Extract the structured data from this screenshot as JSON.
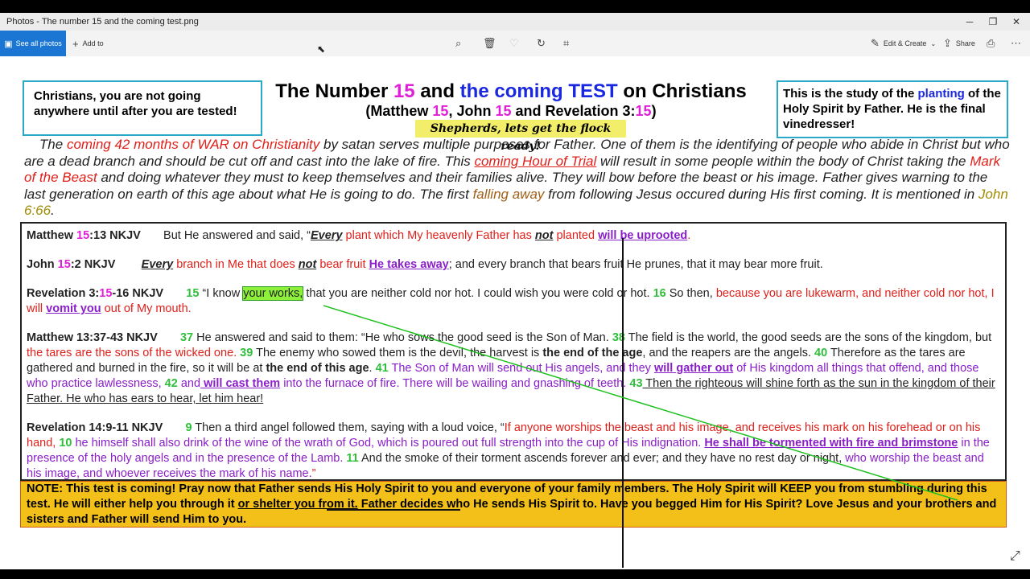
{
  "window": {
    "title": "Photos - The number 15 and the coming test.png",
    "minimize": "─",
    "restore": "❐",
    "close": "✕"
  },
  "toolbar": {
    "see_all_photos": "See all photos",
    "add_to": "Add to",
    "edit_create": "Edit & Create",
    "share": "Share"
  },
  "slide": {
    "left_box": "Christians, you are not going anywhere until after you are tested!",
    "right_box": {
      "a": "This is the study of the ",
      "planting": "planting",
      "b": " of the Holy Spirit by Father. He is the final vinedresser!"
    },
    "title": {
      "a": "The Number ",
      "n": "15",
      "b": " and ",
      "c": "the coming TEST",
      "d": " on Christians"
    },
    "subtitle": {
      "a": "(Matthew ",
      "n1": "15",
      "b": ", John ",
      "n2": "15",
      "c": " and Revelation 3:",
      "n3": "15",
      "d": ")"
    },
    "shepherds": "Shepherds, lets get the flock ready!",
    "intro": {
      "p1": "The ",
      "p2": "coming 42 months of WAR on Christianity",
      "p3": " by satan serves multiple purposes for Father. One of them is the identifying of people who abide in Christ but who are a dead branch and should be cut off and cast into the lake of fire. This ",
      "p4": "coming Hour of Trial",
      "p5": " will result in some people within the body of Christ taking the ",
      "p6": "Mark of the Beast",
      "p7": " and doing whatever they must to keep themselves and their families alive. They will bow before the beast or his image. Father gives warning to the last generation on earth of this age about what He is going to do. The first ",
      "p8": "falling away",
      "p9": " from following Jesus occured during His first coming. It is mentioned in ",
      "p10": "John 6:66",
      "p11": "."
    },
    "matthew15": {
      "ref_a": "Matthew ",
      "ref_n": "15",
      "ref_b": ":13 NKJV",
      "t1": "But He answered and said, “",
      "t2": "Every",
      "t3": " plant which My heavenly Father has ",
      "t4": "not",
      "t5": " planted ",
      "t6": "will be uprooted",
      "t7": "."
    },
    "john15": {
      "ref_a": "John ",
      "ref_n": "15",
      "ref_b": ":2 NKJV",
      "t1": "Every",
      "t2": " branch in Me that does ",
      "t3": "not",
      "t4": " bear fruit ",
      "t5": "He takes away",
      "t6": "; and every branch that bears fruit He prunes, that it may bear more fruit."
    },
    "rev3": {
      "ref_a": "Revelation 3:",
      "ref_n": "15",
      "ref_b": "-16 NKJV",
      "v15": "15",
      "t1": " “I know ",
      "t2": "your works,",
      "t3": " that you are neither cold nor hot. I could wish you were cold or hot. ",
      "v16": "16",
      "t4": " So then, ",
      "t5": "because you are lukewarm, and neither cold nor hot,",
      "t6": " I will ",
      "t7": "vomit you",
      "t8": " out of My mouth."
    },
    "matt13": {
      "ref": "Matthew 13:37-43 NKJV",
      "v37": "37",
      "t1": " He answered and said to them: “He who sows the good seed is the Son of Man. ",
      "v38": "38",
      "t2": " The field is the world, the good seeds are the sons of the kingdom, but ",
      "t3": "the tares are the sons of the wicked one.",
      "v39": " 39",
      "t4": " The enemy who sowed them is the devil, the harvest is ",
      "t5": "the end of the age",
      "t6": ", and the reapers are the angels. ",
      "v40": "40",
      "t7": " Therefore as the tares are gathered and burned in the fire, so it will be at ",
      "t8": "the end of this age",
      "t9": ". ",
      "v41": "41",
      "t10": " The Son of Man will send out His angels, and they ",
      "t11": "will gather out",
      "t12": " of His kingdom all things that offend, and those who practice lawlessness, ",
      "v42": "42",
      "t13": " and",
      "t14": " will cast them",
      "t15": " into the furnace of fire. There will be wailing and gnashing of teeth. ",
      "v43": "43",
      "t16": " Then the righteous will shine forth as the sun in the kingdom of their Father. He who has ears to hear, let him hear!"
    },
    "rev14": {
      "ref": "Revelation 14:9-11 NKJV",
      "v9": "9",
      "t1": " Then a third angel followed them, saying with a loud voice, “",
      "t2": "If anyone worships the beast and his image, and receives his mark on his forehead or on his hand,",
      "v10": " 10",
      "t3": " he himself shall also drink of the wine of the wrath of God, which is poured out full strength into the cup of His indignation.",
      "t4": "He shall be tormented with fire and brimstone",
      "t5": " in the presence of the holy angels and in the presence of the Lamb. ",
      "v11": "11",
      "t6": " And the smoke of their torment ascends forever and ever; and they have no rest day or night, ",
      "t7": "who worship the beast and his image, and whoever receives the mark of his name.",
      "t8": "”"
    },
    "note": {
      "a": "NOTE: This test is coming! Pray now that Father sends His Holy Spirit to you and everyone of your family members. The Holy Spirit will KEEP you from stumbling during this test. He will either help you through it ",
      "b": "or shelter you from it.",
      "c": " Father decides who He sends His Spirit to. Have you begged Him for His Spirit? Love Jesus and your brothers and sisters and Father will send Him to you."
    },
    "expand_icon": "⤢"
  }
}
